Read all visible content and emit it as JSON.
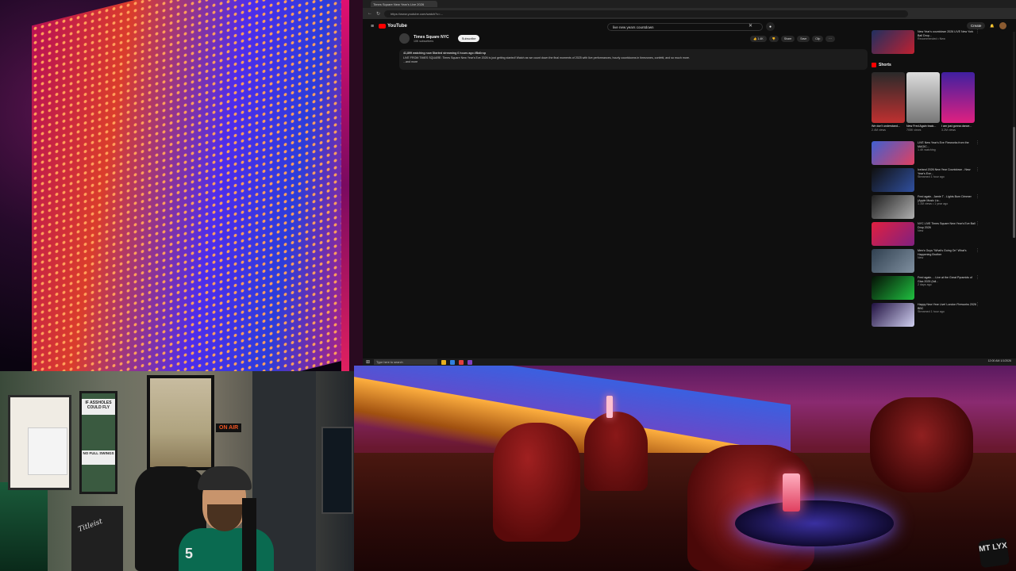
{
  "browser": {
    "tab_title": "Times Square New Year's Live 2026",
    "url": "https://www.youtube.com/watch?v=...",
    "search_value": "live new years countdown",
    "logo": "YouTube",
    "create_label": "Create"
  },
  "video": {
    "channel": "Times Square NYC",
    "subscribers": "10K subscribers",
    "subscribe_label": "Subscribe",
    "likes": "1.4K",
    "share_label": "Share",
    "save_label": "Save",
    "clip_label": "Clip",
    "description_stats": "41,899 watching now  Started streaming 6 hours ago  #Ballrop",
    "description_line1": "LIVE FROM TIMES SQUARE: Times Square New Year's Eve 2026 is just getting started! Watch as we count down the final moments of 2025 with live performances, hourly countdowns in timezones, confetti, and so much more.",
    "description_line2": "...and more"
  },
  "sidebar": {
    "top_item": {
      "title": "New Year's countdown 2026 LIVE New York Ball Drop...",
      "meta": "Recommended • New"
    },
    "shorts_label": "Shorts",
    "shorts": [
      {
        "title": "We don't understand...",
        "meta": "2.4M views"
      },
      {
        "title": "New Fred Again track...",
        "meta": "705K views"
      },
      {
        "title": "I am just gonna dance...",
        "meta": "3.2M views"
      }
    ],
    "videos": [
      {
        "title": "LIVE New Year's Eve Fireworks from the MAGIC...",
        "meta": "1.4K watching"
      },
      {
        "title": "Iceland 2026 New Year Countdown - New Year's Eve...",
        "meta": "Streamed 1 hour ago"
      },
      {
        "title": "Fred again.. Jamie T - Lights Burn Dimmer (Apple Music Liv...",
        "meta": "1.1M views • 1 year ago"
      },
      {
        "title": "NYC LIVE Times Square New Year's Eve Ball Drop 2026",
        "meta": "New"
      },
      {
        "title": "Men's Guys \"What's Going On\" What's Happening Brother",
        "meta": "New"
      },
      {
        "title": "Fred again.. - Live at the Great Pyramids of Giza 2025 (full...",
        "meta": "2 days ago"
      },
      {
        "title": "Happy New Year Live! London Fireworks 2026 BBC",
        "meta": "Streamed 1 hour ago"
      }
    ]
  },
  "taskbar": {
    "search_placeholder": "Type here to search",
    "clock": "12:00 AM 1/1/2026"
  },
  "webcam": {
    "sign_top": "IF ASSHOLES COULD FLY",
    "sign_bottom": "NO FULL SWINGS",
    "on_air": "ON AIR",
    "bag_brand": "Titleist",
    "jersey_number": "5"
  },
  "overlay": {
    "badge_text": "MT LYX"
  },
  "icons": [
    "hamburger-menu-icon",
    "search-icon",
    "mic-icon",
    "bell-icon",
    "like-icon",
    "dislike-icon",
    "share-icon",
    "more-icon"
  ]
}
